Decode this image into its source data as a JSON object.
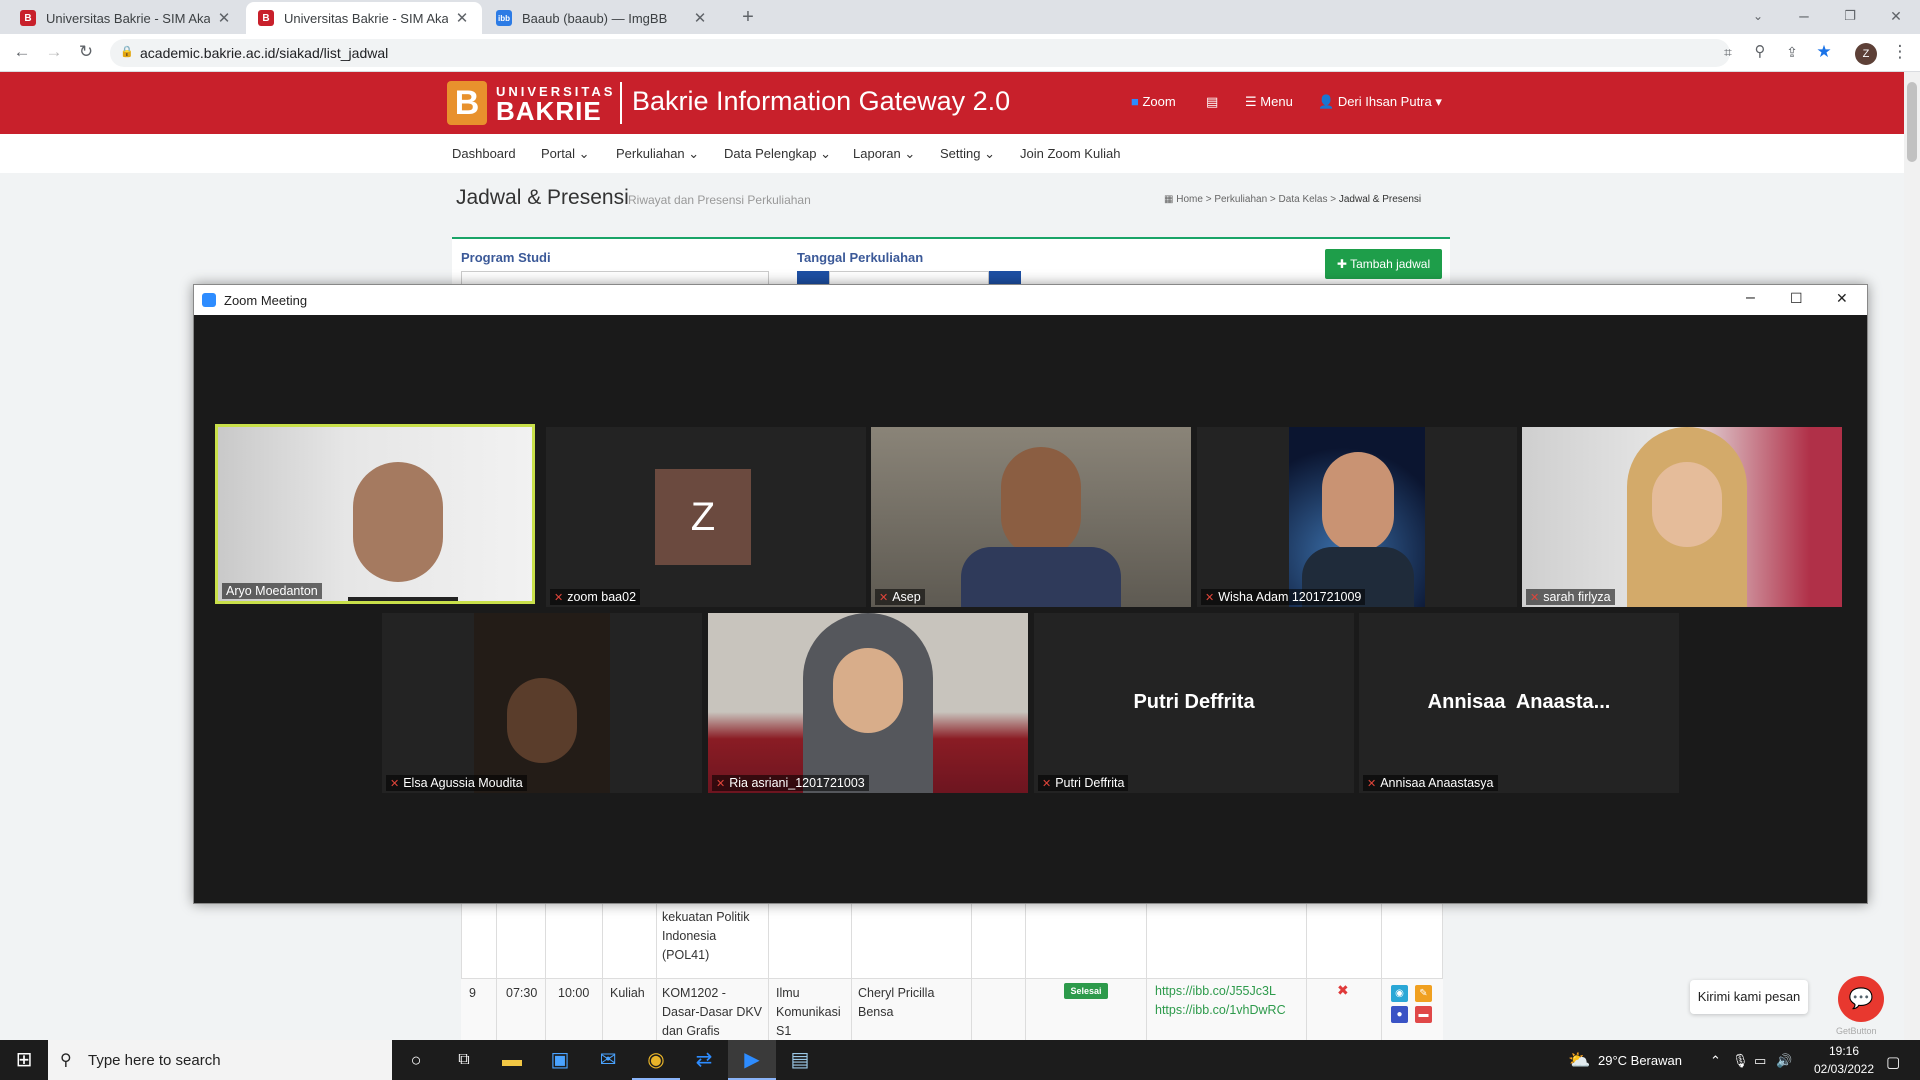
{
  "browser": {
    "tabs": [
      {
        "title": "Universitas Bakrie - SIM Akadem",
        "favicon": "bakrie-icon"
      },
      {
        "title": "Universitas Bakrie - SIM Akadem",
        "favicon": "bakrie-icon"
      },
      {
        "title": "Baaub (baaub) — ImgBB",
        "favicon": "imgbb-icon"
      }
    ],
    "url": "academic.bakrie.ac.id/siakad/list_jadwal",
    "profile_initial": "Z"
  },
  "site": {
    "logo_letter": "B",
    "logo_top": "UNIVERSITAS",
    "logo_name": "BAKRIE",
    "app_title": "Bakrie Information Gateway 2.0",
    "header_links": {
      "zoom": "Zoom",
      "menu": "Menu",
      "user": "Deri Ihsan Putra"
    },
    "menu": [
      "Dashboard",
      "Portal",
      "Perkuliahan",
      "Data Pelengkap",
      "Laporan",
      "Setting",
      "Join Zoom Kuliah"
    ],
    "page_title": "Jadwal & Presensi",
    "page_subtitle": "Riwayat dan Presensi Perkuliahan",
    "breadcrumb": [
      "Home",
      "Perkuliahan",
      "Data Kelas",
      "Jadwal & Presensi"
    ],
    "filter_labels": {
      "program": "Program Studi",
      "date": "Tanggal Perkuliahan"
    },
    "add_button": "Tambah jadwal",
    "table": {
      "row_partial": {
        "course": [
          "kekuatan Politik",
          "Indonesia",
          "(POL41)"
        ]
      },
      "row9": {
        "no": "9",
        "start": "07:30",
        "end": "10:00",
        "type": "Kuliah",
        "course": [
          "KOM1202 -",
          "Dasar-Dasar DKV",
          "dan Grafis"
        ],
        "program": [
          "Ilmu",
          "Komunikasi",
          "S1"
        ],
        "lecturer": [
          "Cheryl Pricilla",
          "Bensa"
        ],
        "status": "Selesai",
        "links": [
          "https://ibb.co/J55Jc3L",
          "https://ibb.co/1vhDwRC"
        ]
      }
    },
    "chat_prompt": "Kirimi kami pesan",
    "chat_brand": "GetButton"
  },
  "zoom": {
    "window_title": "Zoom Meeting",
    "participants": [
      {
        "name": "Aryo Moedanton",
        "muted": false,
        "video": true,
        "active": true
      },
      {
        "name": "zoom baa02",
        "muted": true,
        "video": false,
        "avatar": "Z"
      },
      {
        "name": "Asep",
        "muted": true,
        "video": true
      },
      {
        "name": "Wisha Adam 1201721009",
        "muted": true,
        "video": true
      },
      {
        "name": "sarah firlyza",
        "muted": true,
        "video": true
      },
      {
        "name": "Elsa Agussia Moudita",
        "muted": true,
        "video": true
      },
      {
        "name": "Ria asriani_1201721003",
        "muted": true,
        "video": true
      },
      {
        "name": "Putri Deffrita",
        "muted": true,
        "video": false,
        "display": "Putri Deffrita"
      },
      {
        "name": "Annisaa Anaastasya",
        "muted": true,
        "video": false,
        "display": "Annisaa  Anaasta..."
      }
    ]
  },
  "taskbar": {
    "search_placeholder": "Type here to search",
    "weather": "29°C  Berawan",
    "time": "19:16",
    "date": "02/03/2022"
  },
  "colors": {
    "brand_red": "#c8202b",
    "green": "#1e9e4a",
    "zoom_bg": "#1a1a1a",
    "active_speaker": "#c9e04a"
  }
}
